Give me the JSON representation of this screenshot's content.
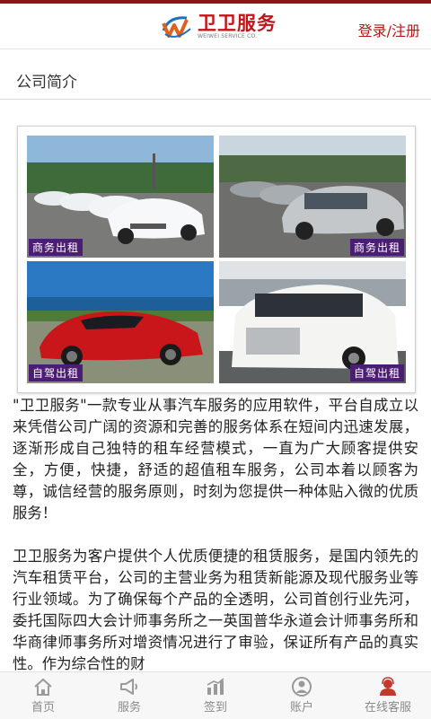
{
  "header": {
    "logo_title": "卫卫服务",
    "logo_subtitle": "WEIWEI SERVICE CO.",
    "login_label": "登录/注册"
  },
  "section": {
    "title": "公司简介"
  },
  "photos": [
    {
      "tag": "商务出租",
      "subject": "white sedans parked in a row"
    },
    {
      "tag": "商务出租",
      "subject": "silver minivans parked in a row"
    },
    {
      "tag": "自驾出租",
      "subject": "red electric sports sedan"
    },
    {
      "tag": "自驾出租",
      "subject": "white luxury MPV"
    }
  ],
  "article": {
    "paragraphs": [
      "\"卫卫服务\"一款专业从事汽车服务的应用软件，平台自成立以来凭借公司广阔的资源和完善的服务体系在短间内迅速发展，逐渐形成自己独特的租车经营模式，一直为广大顾客提供安全，方便，快捷，舒适的超值租车服务，公司本着以顾客为尊，诚信经营的服务原则，时刻为您提供一种体贴入微的优质服务！",
      "卫卫服务为客户提供个人优质便捷的租赁服务，是国内领先的汽车租赁平台，公司的主营业务为租赁新能源及现代服务业等行业领域。为了确保每个产品的全透明，公司首创行业先河，委托国际四大会计师事务所之一英国普华永道会计师事务所和华商律师事务所对增资情况进行了审验，保证所有产品的真实性。作为综合性的财"
    ]
  },
  "nav": {
    "items": [
      {
        "label": "首页",
        "icon": "home-icon"
      },
      {
        "label": "服务",
        "icon": "megaphone-icon"
      },
      {
        "label": "签到",
        "icon": "chart-icon"
      },
      {
        "label": "账户",
        "icon": "user-icon"
      },
      {
        "label": "在线客服",
        "icon": "support-agent-icon"
      }
    ]
  },
  "colors": {
    "brand_red": "#b3181d",
    "tag_purple": "#4b1e73",
    "nav_gray": "#8a8a8a",
    "active_icon": "#c0392b"
  }
}
